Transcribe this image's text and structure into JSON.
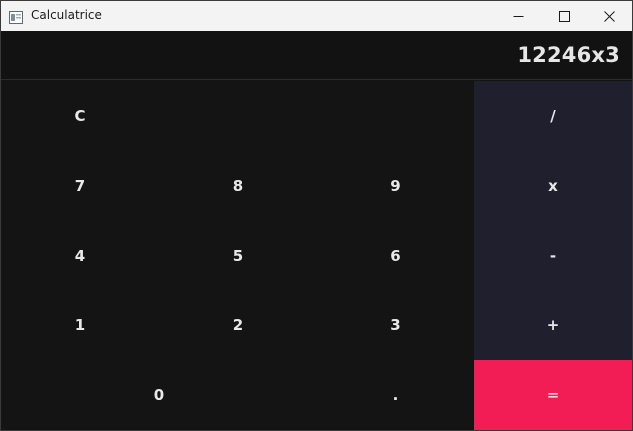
{
  "window": {
    "title": "Calculatrice"
  },
  "display": {
    "expression": "12246x3"
  },
  "keys": {
    "clear": "C",
    "divide": "/",
    "seven": "7",
    "eight": "8",
    "nine": "9",
    "multiply": "x",
    "four": "4",
    "five": "5",
    "six": "6",
    "minus": "-",
    "one": "1",
    "two": "2",
    "three": "3",
    "plus": "+",
    "zero": "0",
    "dot": ".",
    "equals": "="
  },
  "colors": {
    "background": "#141414",
    "operator_column": "#1f1f2d",
    "equals_accent": "#f21d55",
    "text": "#e8e8e8"
  }
}
